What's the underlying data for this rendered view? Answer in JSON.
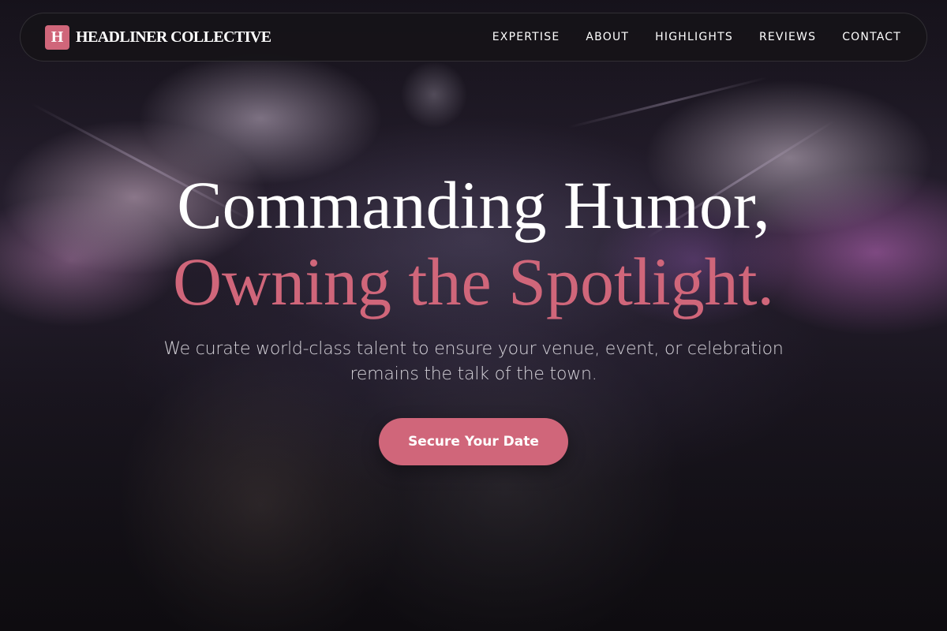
{
  "brand": {
    "mark": "H",
    "name": "HEADLINER COLLECTIVE"
  },
  "nav": {
    "links": [
      {
        "label": "EXPERTISE"
      },
      {
        "label": "ABOUT"
      },
      {
        "label": "HIGHLIGHTS"
      },
      {
        "label": "REVIEWS"
      },
      {
        "label": "CONTACT"
      }
    ]
  },
  "hero": {
    "headline_line1": "Commanding Humor,",
    "headline_line2": "Owning the Spotlight.",
    "tagline": "We curate world-class talent to ensure your venue, event, or celebration remains the talk of the town.",
    "cta_label": "Secure Your Date"
  },
  "colors": {
    "accent": "#d0667a",
    "nav_bg": "#161418",
    "text_primary": "#ffffff"
  },
  "icons": {
    "brand_mark": "letter-h-logo"
  }
}
